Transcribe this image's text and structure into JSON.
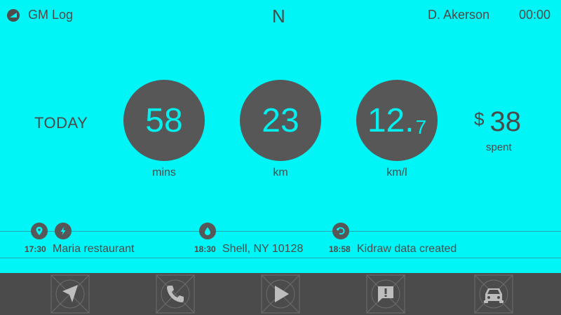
{
  "header": {
    "app_icon": "gm-log-icon",
    "app_title": "GM Log",
    "compass": "N",
    "user": "D. Akerson",
    "clock": "00:00"
  },
  "summary": {
    "period": "TODAY",
    "stats": [
      {
        "value": "58",
        "decimal": "",
        "unit": "mins"
      },
      {
        "value": "23",
        "decimal": "",
        "unit": "km"
      },
      {
        "value": "12.",
        "decimal": "7",
        "unit": "km/l"
      }
    ],
    "spent": {
      "currency": "$",
      "value": "38",
      "label": "spent"
    }
  },
  "timeline": [
    {
      "icons": [
        "location-pin-icon",
        "lightning-icon"
      ],
      "time": "17:30",
      "text": "Maria restaurant"
    },
    {
      "icons": [
        "fuel-drop-icon"
      ],
      "time": "18:30",
      "text": "Shell, NY 10128"
    },
    {
      "icons": [
        "data-curve-icon"
      ],
      "time": "18:58",
      "text": "Kidraw data created"
    }
  ],
  "nav": {
    "items": [
      "navigation-icon",
      "phone-icon",
      "play-icon",
      "alert-message-icon",
      "car-icon"
    ],
    "accent_color": "#00f6f6",
    "bar_color": "#4b4b4b"
  }
}
